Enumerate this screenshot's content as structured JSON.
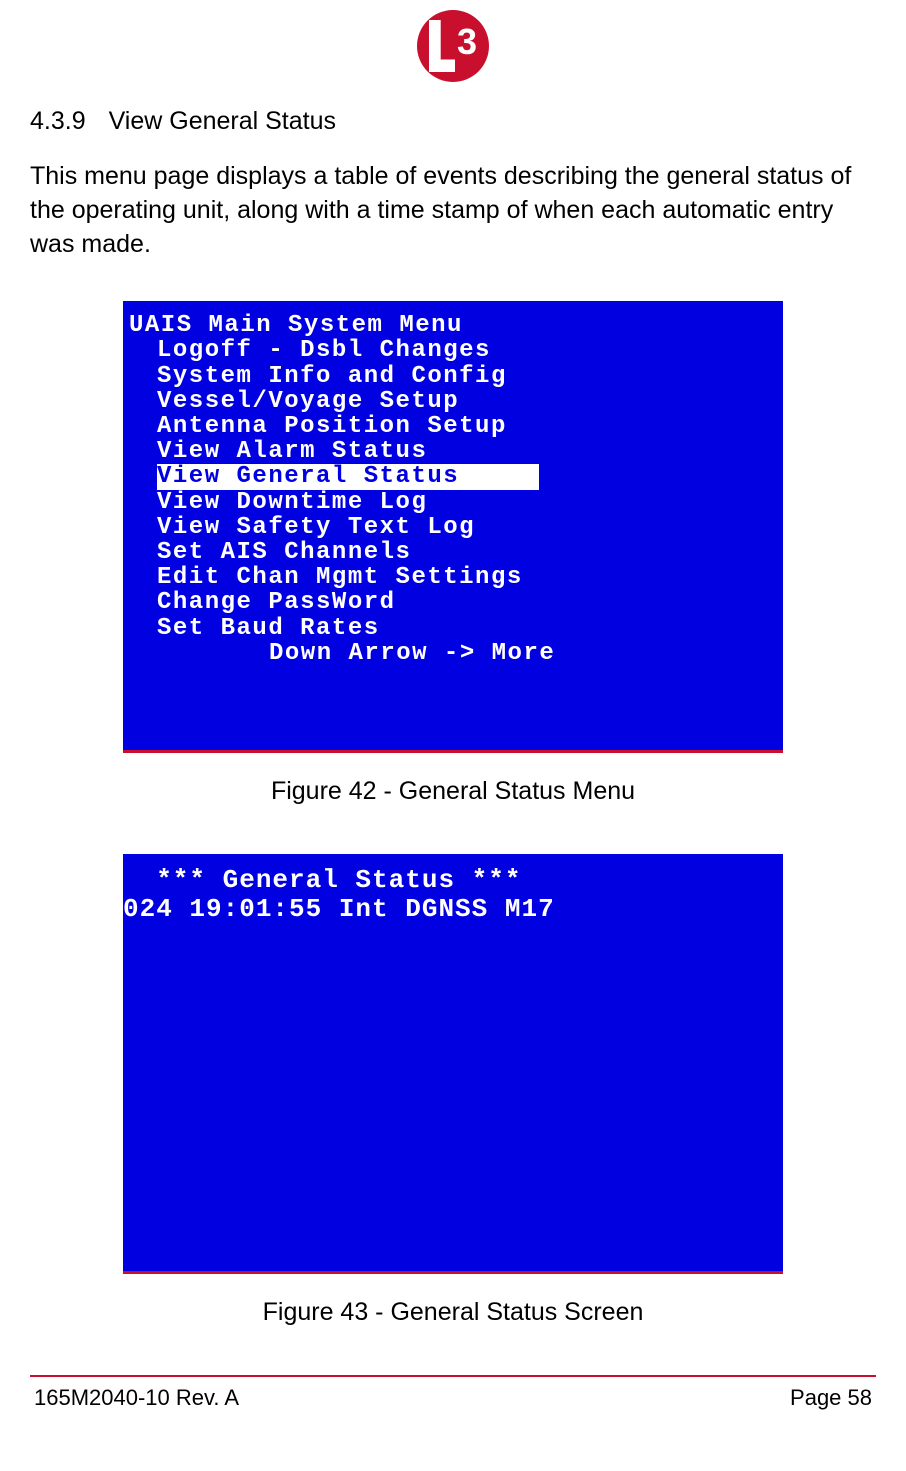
{
  "logo": {
    "text": "3"
  },
  "section": {
    "number": "4.3.9",
    "title": "View General Status"
  },
  "paragraph": "This menu page displays a table of events describing the general status of the operating unit, along with a time stamp of when each automatic entry was made.",
  "figure42": {
    "caption": "Figure 42 - General Status Menu",
    "terminal": {
      "title": "UAIS Main System Menu",
      "items": [
        "Logoff - Dsbl Changes",
        "System Info and Config",
        "Vessel/Voyage Setup",
        "Antenna Position Setup",
        "View Alarm Status",
        "View General Status",
        "View Downtime Log",
        "View Safety Text Log",
        "Set AIS Channels",
        "Edit Chan Mgmt Settings",
        "Change PassWord",
        "Set Baud Rates"
      ],
      "highlighted_index": 5,
      "footer": "Down Arrow -> More"
    }
  },
  "figure43": {
    "caption": "Figure 43 - General Status Screen",
    "terminal": {
      "title": "  *** General Status ***",
      "line": "024 19:01:55 Int DGNSS M17"
    }
  },
  "footer": {
    "left": "165M2040-10 Rev. A",
    "right": "Page 58"
  }
}
